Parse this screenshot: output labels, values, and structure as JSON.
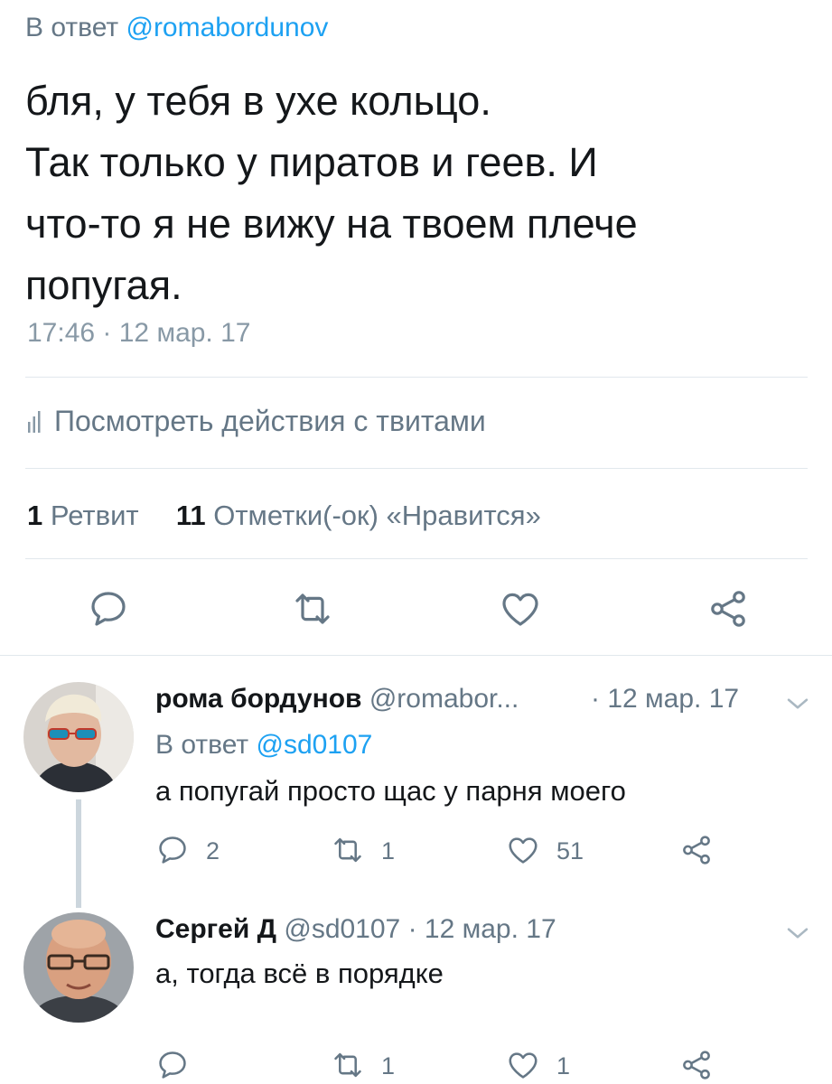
{
  "tweet": {
    "reply_prefix": "В ответ",
    "reply_handle": "@romabordunov",
    "text_lines": [
      "бля, у тебя в ухе кольцо.",
      "Так только у пиратов и геев. И",
      "что-то я не вижу на твоем плече",
      "попугая."
    ],
    "timestamp": "17:46 · 12 мар. 17",
    "analytics_label": "Посмотреть действия с твитами",
    "retweet_count": "1",
    "retweet_label": "Ретвит",
    "like_count": "11",
    "like_label": "Отметки(-ок) «Нравится»"
  },
  "replies": [
    {
      "name": "рома бордунов",
      "handle": "@romabor...",
      "date": "· 12 мар. 17",
      "reply_prefix": "В ответ",
      "reply_handle": "@sd0107",
      "text": "а попугай просто щас у парня моего",
      "reply_count": "2",
      "retweet_count": "1",
      "like_count": "51"
    },
    {
      "name": "Сергей Д",
      "handle": "@sd0107",
      "date": "· 12 мар. 17",
      "text": "а, тогда всё в порядке",
      "reply_count": "",
      "retweet_count": "1",
      "like_count": "1"
    }
  ],
  "icons": {
    "reply": "reply-icon",
    "retweet": "retweet-icon",
    "like": "heart-icon",
    "share": "share-icon",
    "analytics": "bar-chart-icon",
    "caret": "chevron-down-icon"
  },
  "colors": {
    "link": "#1da1f2",
    "secondary": "#657786",
    "divider": "#e1e8ed",
    "text": "#14171a"
  }
}
